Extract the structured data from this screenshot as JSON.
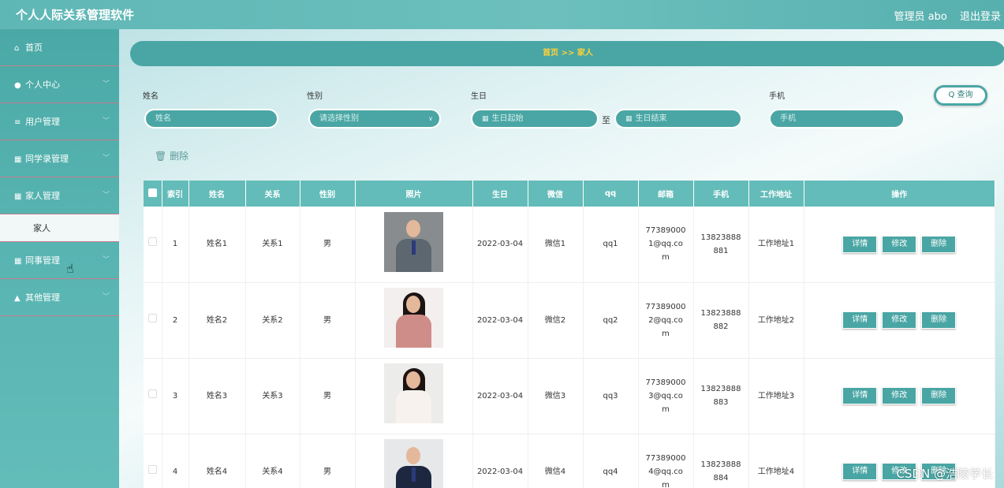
{
  "app": {
    "title": "个人人际关系管理软件",
    "user": "管理员 abo",
    "logout": "退出登录"
  },
  "sidebar": {
    "items": [
      {
        "label": "首页",
        "icon": "home-icon",
        "glyph": "⌂"
      },
      {
        "label": "个人中心",
        "icon": "user-icon",
        "glyph": "●"
      },
      {
        "label": "用户管理",
        "icon": "list-icon",
        "glyph": "≡"
      },
      {
        "label": "同学录管理",
        "icon": "grid-icon",
        "glyph": "▦"
      },
      {
        "label": "家人管理",
        "icon": "grid-icon",
        "glyph": "▦"
      },
      {
        "label": "同事管理",
        "icon": "grid-icon",
        "glyph": "▦"
      },
      {
        "label": "其他管理",
        "icon": "thumb-icon",
        "glyph": "▲"
      }
    ],
    "submenu": {
      "label": "家人"
    }
  },
  "breadcrumb": {
    "text": "首页 >> 家人"
  },
  "search": {
    "name_label": "姓名",
    "name_placeholder": "姓名",
    "gender_label": "性别",
    "gender_placeholder": "请选择性别",
    "birthday_label": "生日",
    "birthday_start": "生日起始",
    "birthday_to": "至",
    "birthday_end": "生日结束",
    "phone_label": "手机",
    "phone_placeholder": "手机",
    "button": "查询"
  },
  "toolbar": {
    "delete": "删除"
  },
  "table": {
    "headers": [
      "索引",
      "姓名",
      "关系",
      "性别",
      "照片",
      "生日",
      "微信",
      "qq",
      "邮箱",
      "手机",
      "工作地址",
      "操作"
    ],
    "actions": [
      "详情",
      "修改",
      "删除"
    ],
    "rows": [
      {
        "index": "1",
        "name": "姓名1",
        "relation": "关系1",
        "gender": "男",
        "birthday": "2022-03-04",
        "wechat": "微信1",
        "qq": "qq1",
        "email": "773890001@qq.com",
        "phone": "13823888881",
        "address": "工作地址1"
      },
      {
        "index": "2",
        "name": "姓名2",
        "relation": "关系2",
        "gender": "男",
        "birthday": "2022-03-04",
        "wechat": "微信2",
        "qq": "qq2",
        "email": "773890002@qq.com",
        "phone": "13823888882",
        "address": "工作地址2"
      },
      {
        "index": "3",
        "name": "姓名3",
        "relation": "关系3",
        "gender": "男",
        "birthday": "2022-03-04",
        "wechat": "微信3",
        "qq": "qq3",
        "email": "773890003@qq.com",
        "phone": "13823888883",
        "address": "工作地址3"
      },
      {
        "index": "4",
        "name": "姓名4",
        "relation": "关系4",
        "gender": "男",
        "birthday": "2022-03-04",
        "wechat": "微信4",
        "qq": "qq4",
        "email": "773890004@qq.com",
        "phone": "13823888884",
        "address": "工作地址4"
      }
    ]
  },
  "watermark": "CSDN @浩陵学长"
}
